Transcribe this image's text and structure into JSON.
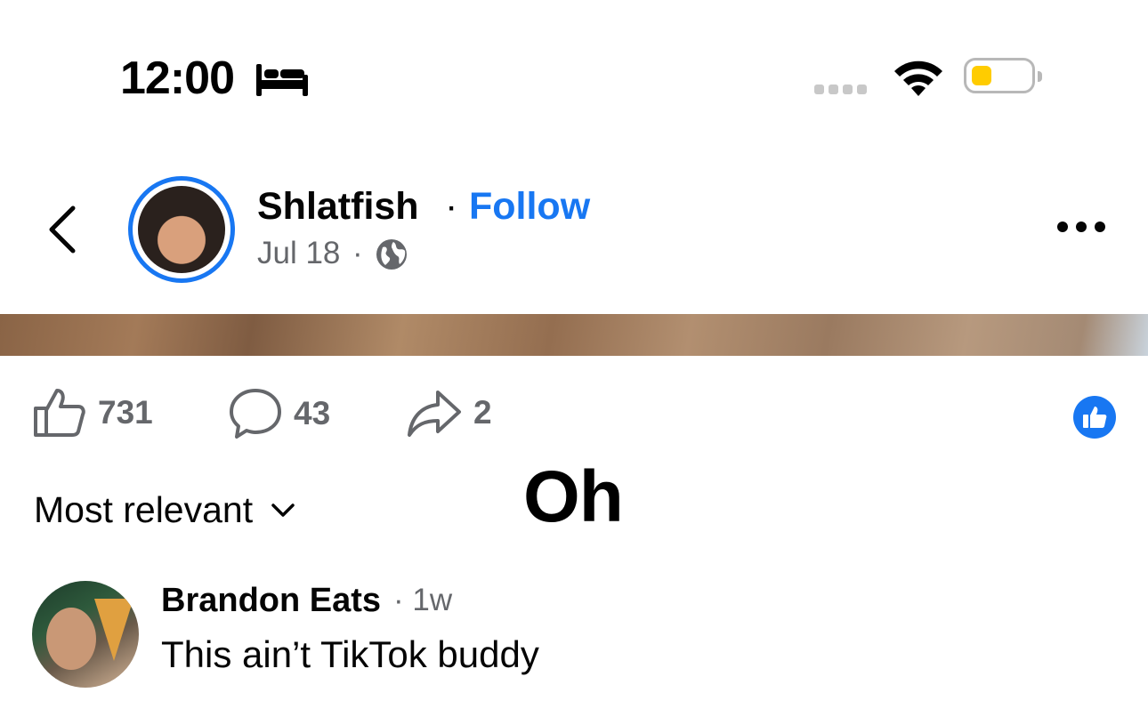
{
  "status_bar": {
    "time": "12:00",
    "focus_icon": "bed-icon",
    "signal_icon": "cellular-signal-icon",
    "wifi_icon": "wifi-icon",
    "battery_icon": "battery-low-icon",
    "battery_color": "#ffcc00"
  },
  "header": {
    "back_icon": "chevron-left-icon",
    "author_name": "Shlatfish",
    "separator": "·",
    "follow_label": "Follow",
    "post_date": "Jul 18",
    "date_separator": "·",
    "audience_icon": "globe-icon",
    "more_icon": "more-horizontal-icon"
  },
  "actions": {
    "like_count": "731",
    "comment_count": "43",
    "share_count": "2",
    "like_icon": "thumbs-up-outline-icon",
    "comment_icon": "comment-bubble-icon",
    "share_icon": "share-arrow-icon",
    "reaction_icon": "like-reaction-icon"
  },
  "comments": {
    "sort_label": "Most relevant",
    "sort_icon": "chevron-down-icon",
    "items": [
      {
        "author": "Brandon Eats",
        "meta": "· 1w",
        "text": "This ain’t TikTok buddy"
      }
    ]
  },
  "overlay": {
    "caption": "Oh"
  },
  "colors": {
    "accent": "#1877f2",
    "secondary_text": "#65676b",
    "primary_text": "#050505"
  }
}
